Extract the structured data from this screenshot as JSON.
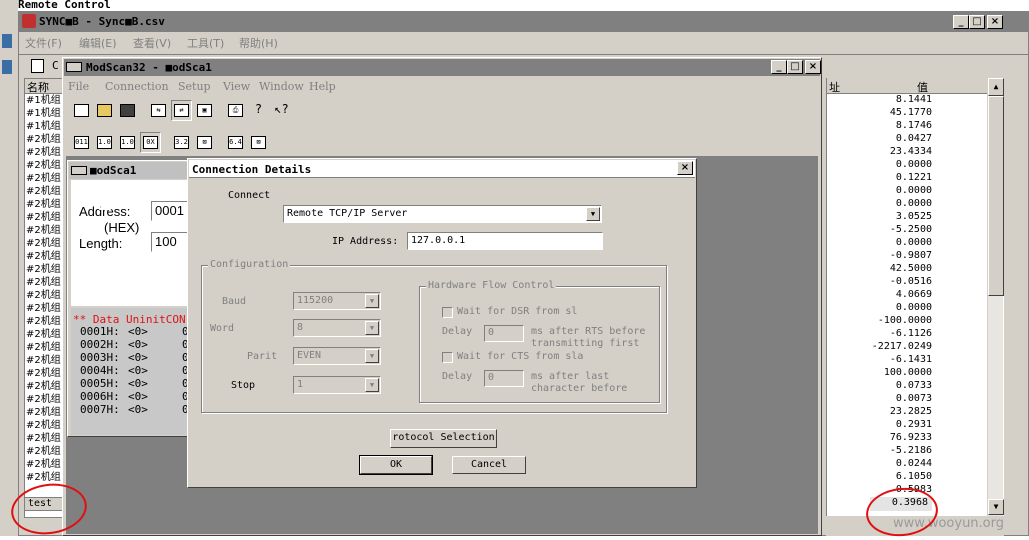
{
  "top_caption": "Remote Control",
  "outer_window": {
    "title": "SYNC■B - Sync■B.csv",
    "menu": [
      "文件(F)",
      "编辑(E)",
      "查看(V)",
      "工具(T)",
      "帮助(H)"
    ],
    "left_column_header": "名称",
    "right_column_header_addr": "址",
    "right_column_header_value": "值",
    "left_rows": [
      "#1机组",
      "#1机组",
      "#1机组",
      "#2机组",
      "#2机组",
      "#2机组",
      "#2机组",
      "#2机组",
      "#2机组",
      "#2机组",
      "#2机组",
      "#2机组",
      "#2机组",
      "#2机组",
      "#2机组",
      "#2机组",
      "#2机组",
      "#2机组",
      "#2机组",
      "#2机组",
      "#2机组",
      "#2机组",
      "#2机组",
      "#2机组",
      "#2机组",
      "#2机组",
      "#2机组",
      "#2机组",
      "#2机组",
      "#2机组"
    ],
    "left_selected": "test",
    "right_values": [
      "8.1441",
      "45.1770",
      "8.1746",
      "0.0427",
      "23.4334",
      "0.0000",
      "0.1221",
      "0.0000",
      "0.0000",
      "3.0525",
      "-5.2500",
      "0.0000",
      "-0.9807",
      "42.5000",
      "-0.0516",
      "4.0669",
      "0.0000",
      "-100.0000",
      "-6.1126",
      "-2217.0249",
      "-6.1431",
      "100.0000",
      "0.0733",
      "0.0073",
      "23.2825",
      "0.2931",
      "76.9233",
      "-5.2186",
      "0.0244",
      "6.1050",
      "0.5983"
    ],
    "right_selected": "0.3968"
  },
  "modscan_window": {
    "title": "ModScan32 - ■odSca1",
    "menu": [
      "File",
      "Connection",
      "Setup",
      "View",
      "Window",
      "Help"
    ]
  },
  "child_window": {
    "title": "■odSca1",
    "address_label": "Address:",
    "address_value": "0001",
    "hex_label": "(HEX)",
    "length_label": "Length:",
    "length_value": "100",
    "status": "** Data UninitCON",
    "rows": [
      {
        "addr": "0001H:",
        "val": "<0>",
        "tail": "0"
      },
      {
        "addr": "0002H:",
        "val": "<0>",
        "tail": "0"
      },
      {
        "addr": "0003H:",
        "val": "<0>",
        "tail": "0"
      },
      {
        "addr": "0004H:",
        "val": "<0>",
        "tail": "0"
      },
      {
        "addr": "0005H:",
        "val": "<0>",
        "tail": "0"
      },
      {
        "addr": "0006H:",
        "val": "<0>",
        "tail": "0"
      },
      {
        "addr": "0007H:",
        "val": "<0>",
        "tail": "0"
      }
    ]
  },
  "dialog": {
    "title": "Connection Details",
    "connect_label": "Connect",
    "connect_value": "Remote TCP/IP Server",
    "ip_label": "IP Address:",
    "ip_value": "127.0.0.1",
    "config_label": "Configuration",
    "baud_label": "Baud",
    "baud_value": "115200",
    "word_label": "Word",
    "word_value": "8",
    "parity_label": "Parit",
    "parity_value": "EVEN",
    "stop_label": "Stop",
    "stop_value": "1",
    "hw_label": "Hardware Flow Control",
    "dsr_label": "Wait for DSR from sl",
    "delay1_label": "Delay",
    "delay1_value": "0",
    "delay1_note": "ms after RTS before\ntransmitting first",
    "cts_label": "Wait for CTS from sla",
    "delay2_label": "Delay",
    "delay2_value": "0",
    "delay2_note": "ms after last\ncharacter before",
    "protocol_button": "rotocol Selection",
    "ok_button": "OK",
    "cancel_button": "Cancel"
  },
  "watermark": "www.wooyun.org",
  "colors": {
    "annotation_red": "#e01010",
    "win_gray": "#d4d0c8",
    "dark_gray": "#808080"
  }
}
